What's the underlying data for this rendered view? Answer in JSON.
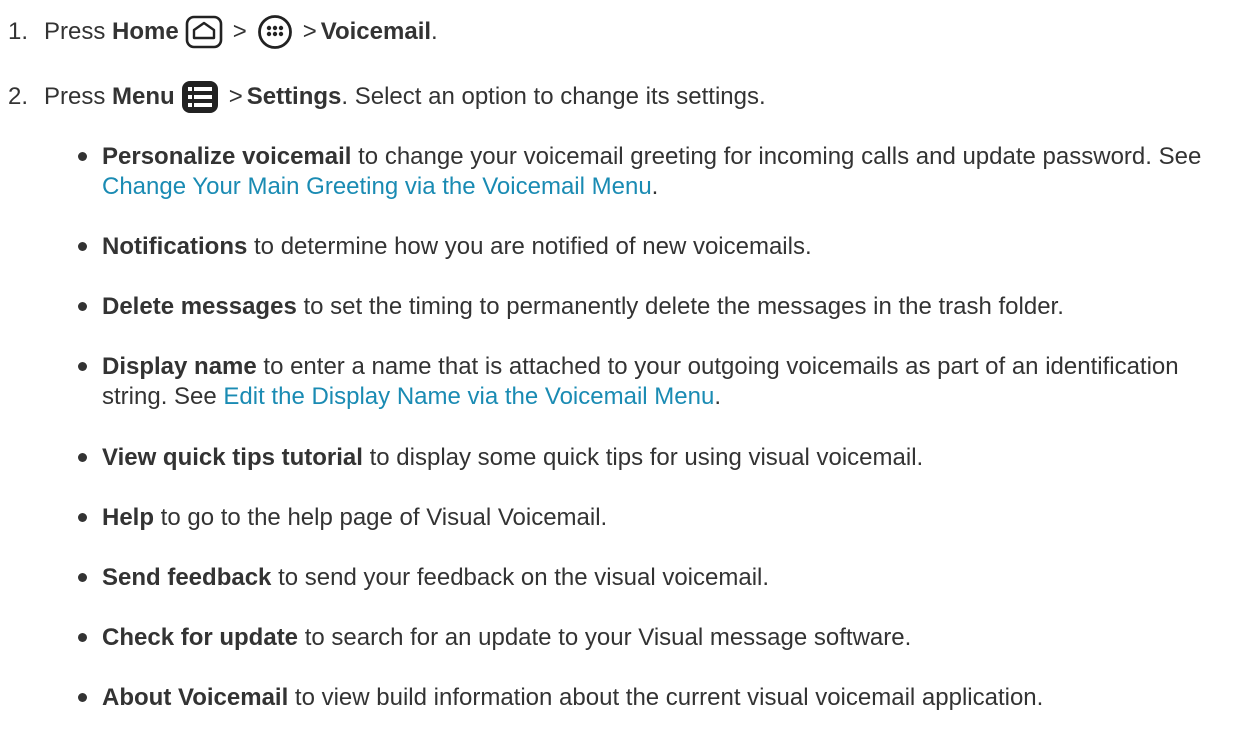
{
  "steps": [
    {
      "number": "1.",
      "pre": "Press",
      "bold1": "Home",
      "icon1": "home-icon",
      "gt1": ">",
      "icon2": "apps-icon",
      "gt2": ">",
      "bold2": "Voicemail",
      "post": "."
    },
    {
      "number": "2.",
      "pre": "Press",
      "bold1": "Menu",
      "icon1": "menu-icon",
      "gt1": ">",
      "bold2": "Settings",
      "post": ". Select an option to change its settings."
    }
  ],
  "options": [
    {
      "term": "Personalize voicemail",
      "desc": " to change your voicemail greeting for incoming calls and update password. See ",
      "link": "Change Your Main Greeting via the Voicemail Menu",
      "end": "."
    },
    {
      "term": "Notifications",
      "desc": " to determine how you are notified of new voicemails."
    },
    {
      "term": "Delete messages",
      "desc": " to set the timing to permanently delete the messages in the trash folder."
    },
    {
      "term": "Display name",
      "desc": " to enter a name that is attached to your outgoing voicemails as part of an identification string. See ",
      "link": "Edit the Display Name via the Voicemail Menu",
      "end": "."
    },
    {
      "term": "View quick tips tutorial",
      "desc": " to display some quick tips for using visual voicemail."
    },
    {
      "term": "Help",
      "desc": " to go to the help page of Visual Voicemail."
    },
    {
      "term": "Send feedback",
      "desc": " to send your feedback on the visual voicemail."
    },
    {
      "term": "Check for update",
      "desc": " to search for an update to your Visual message software."
    },
    {
      "term": "About Voicemail",
      "desc": " to view build information about the current visual voicemail application."
    }
  ]
}
